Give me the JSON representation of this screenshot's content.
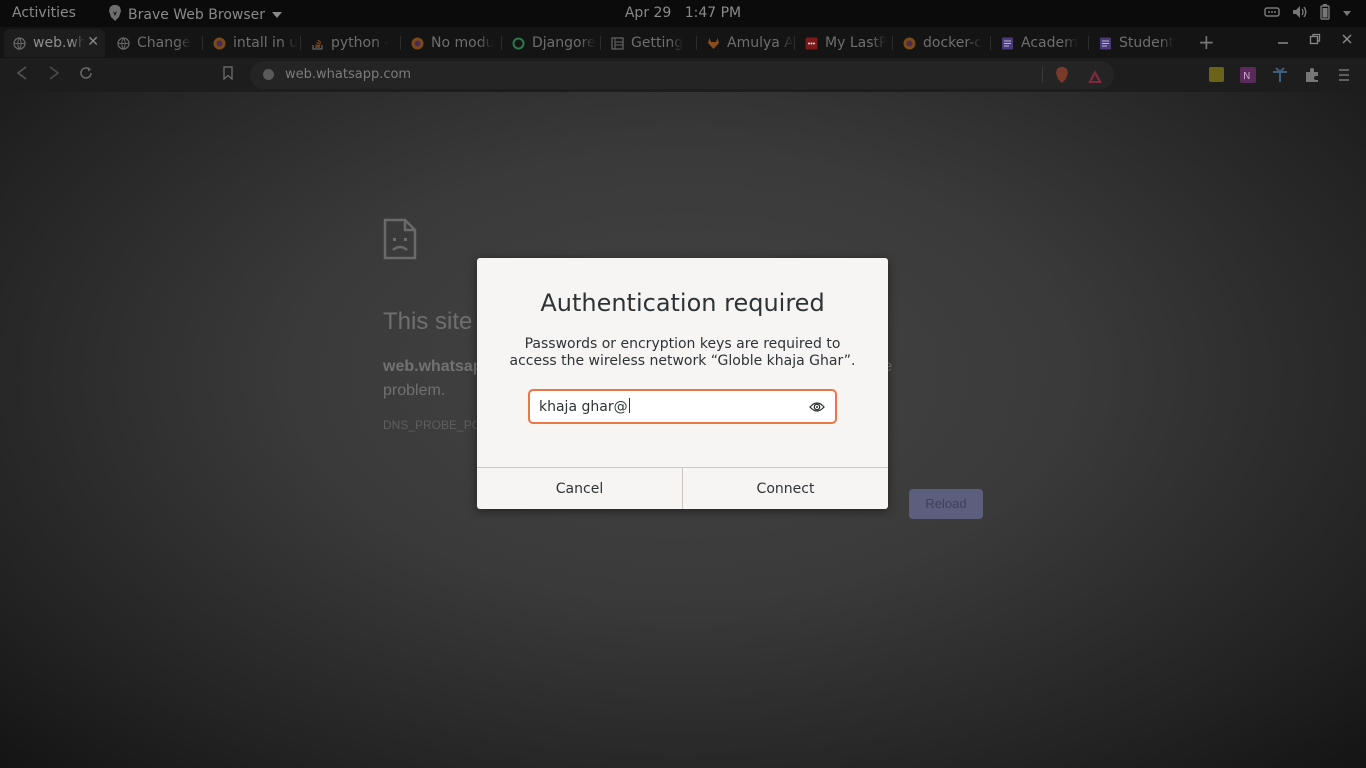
{
  "system_bar": {
    "activities_label": "Activities",
    "app_name": "Brave Web Browser",
    "date": "Apr 29",
    "time": "1:47 PM"
  },
  "tabs": [
    {
      "title": "web.whatsapp.com",
      "icon": "globe-icon",
      "active": true
    },
    {
      "title": "Change",
      "icon": "globe-icon"
    },
    {
      "title": "intall in u",
      "icon": "firefox-icon"
    },
    {
      "title": "python -",
      "icon": "stackoverflow-icon"
    },
    {
      "title": "No modu",
      "icon": "firefox-icon"
    },
    {
      "title": "Djangore",
      "icon": "ring-icon"
    },
    {
      "title": "Getting",
      "icon": "docs-icon"
    },
    {
      "title": "Amulya A",
      "icon": "gitlab-icon"
    },
    {
      "title": "My LastP",
      "icon": "lastpass-icon"
    },
    {
      "title": "docker-c",
      "icon": "firefox-icon"
    },
    {
      "title": "Academ",
      "icon": "form-icon"
    },
    {
      "title": "Student",
      "icon": "form-icon"
    }
  ],
  "address_bar": {
    "url": "web.whatsapp.com"
  },
  "extensions": {
    "badge_count": "3"
  },
  "error_page": {
    "title": "This site can’t be reached",
    "host": "web.whatsapp.com",
    "message": "’s DNS address could not be found. Diagnosing the problem.",
    "code": "DNS_PROBE_POSSIBLE",
    "reload_label": "Reload"
  },
  "dialog": {
    "title": "Authentication required",
    "message_line1": "Passwords or encryption keys are required to",
    "message_line2": "access the wireless network “Globle khaja Ghar”.",
    "password_value": "khaja ghar@",
    "cancel_label": "Cancel",
    "connect_label": "Connect"
  },
  "colors": {
    "focus_accent": "#e9774a",
    "reload_button": "#5c5e7d",
    "dialog_bg": "#f6f5f4"
  }
}
